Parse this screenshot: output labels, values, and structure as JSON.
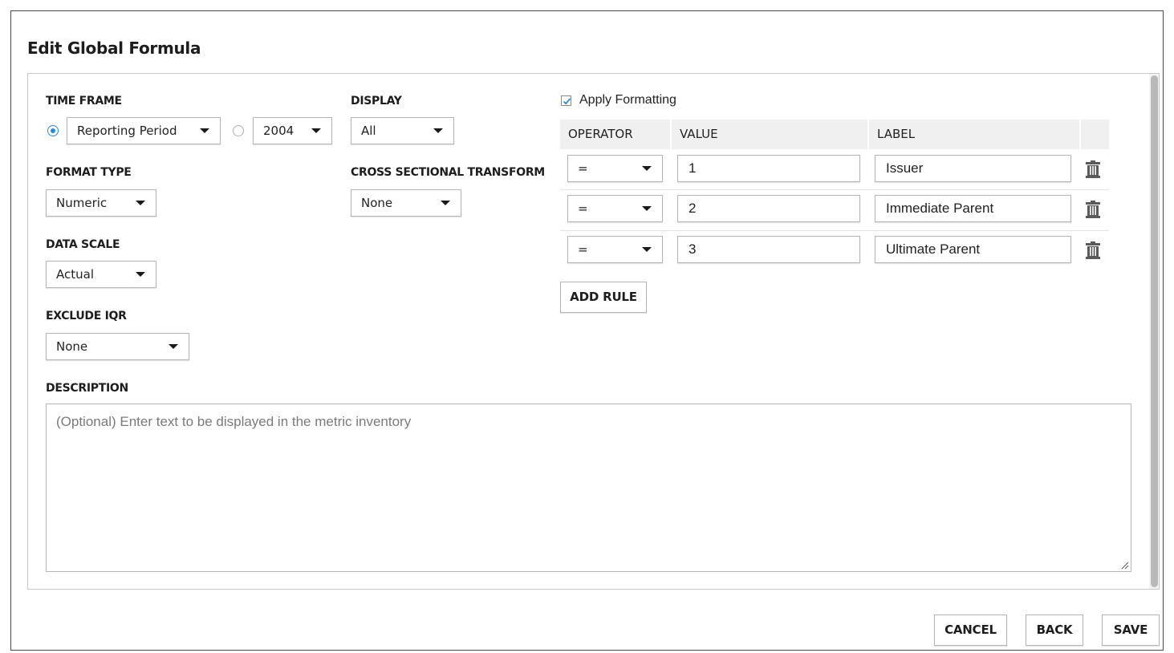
{
  "dialog": {
    "title": "Edit Global Formula"
  },
  "time_frame": {
    "label": "TIME FRAME",
    "option_reporting_period": "Reporting Period",
    "option_year": "2004",
    "selected": "Reporting Period"
  },
  "display": {
    "label": "DISPLAY",
    "value": "All"
  },
  "format_type": {
    "label": "FORMAT TYPE",
    "value": "Numeric"
  },
  "cross_sectional_transform": {
    "label": "CROSS SECTIONAL TRANSFORM",
    "value": "None"
  },
  "data_scale": {
    "label": "DATA SCALE",
    "value": "Actual"
  },
  "exclude_iqr": {
    "label": "EXCLUDE IQR",
    "value": "None"
  },
  "formatting": {
    "apply_label": "Apply Formatting",
    "apply_checked": true,
    "headers": {
      "operator": "OPERATOR",
      "value": "VALUE",
      "label": "LABEL"
    },
    "rules": [
      {
        "operator": "=",
        "value": "1",
        "label": "Issuer"
      },
      {
        "operator": "=",
        "value": "2",
        "label": "Immediate Parent"
      },
      {
        "operator": "=",
        "value": "3",
        "label": "Ultimate Parent"
      }
    ],
    "add_rule_label": "ADD RULE"
  },
  "description": {
    "label": "DESCRIPTION",
    "placeholder": "(Optional) Enter text to be displayed in the metric inventory"
  },
  "footer": {
    "cancel_label": "CANCEL",
    "back_label": "BACK",
    "save_label": "SAVE"
  },
  "colors": {
    "accent": "#2a8cd0",
    "border": "#b5b5b5",
    "header_bg": "#f0f0f0"
  },
  "icons": {
    "checkbox_check": "check-icon",
    "delete": "trash-icon",
    "dropdown": "caret-down-icon"
  }
}
